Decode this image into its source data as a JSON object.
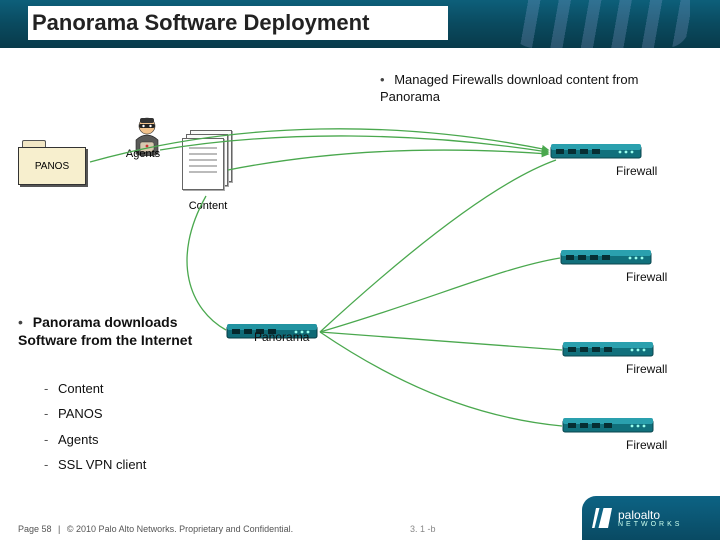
{
  "header": {
    "title": "Panorama Software Deployment"
  },
  "top_bullet": "Managed Firewalls download content from Panorama",
  "folder_label": "PANOS",
  "agents_label": "Agents",
  "content_label": "Content",
  "panorama_label": "Panorama",
  "firewall_label": "Firewall",
  "left_bullet": "Panorama downloads Software from the Internet",
  "sublist": [
    "Content",
    "PANOS",
    "Agents",
    "SSL VPN client"
  ],
  "footer": {
    "page_label": "Page 58",
    "separator": "|",
    "copyright": "© 2010 Palo Alto Networks. Proprietary and Confidential.",
    "slide_num": "3. 1 -b"
  },
  "logo": {
    "brand": "paloalto",
    "sub": "NETWORKS"
  },
  "colors": {
    "header_grad_top": "#0d5f7a",
    "device_teal": "#157f8f",
    "wire_green": "#4aa84e"
  }
}
